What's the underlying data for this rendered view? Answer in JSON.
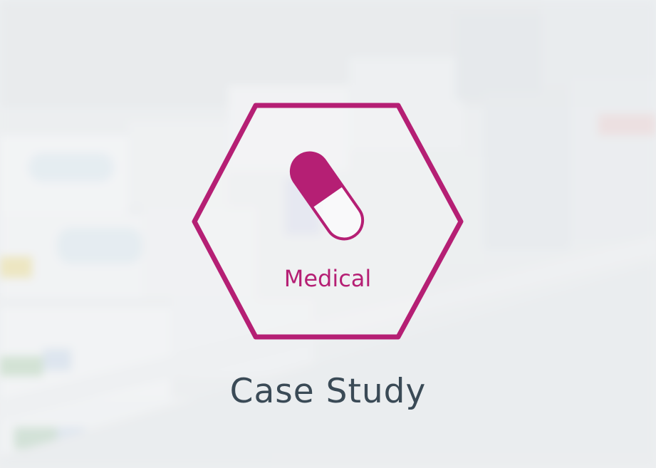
{
  "badge": {
    "label": "Medical",
    "icon": "capsule-icon",
    "accent_color": "#b51f74"
  },
  "title": "Case Study",
  "colors": {
    "title": "#3a4a56",
    "background": "#e9ecee"
  }
}
